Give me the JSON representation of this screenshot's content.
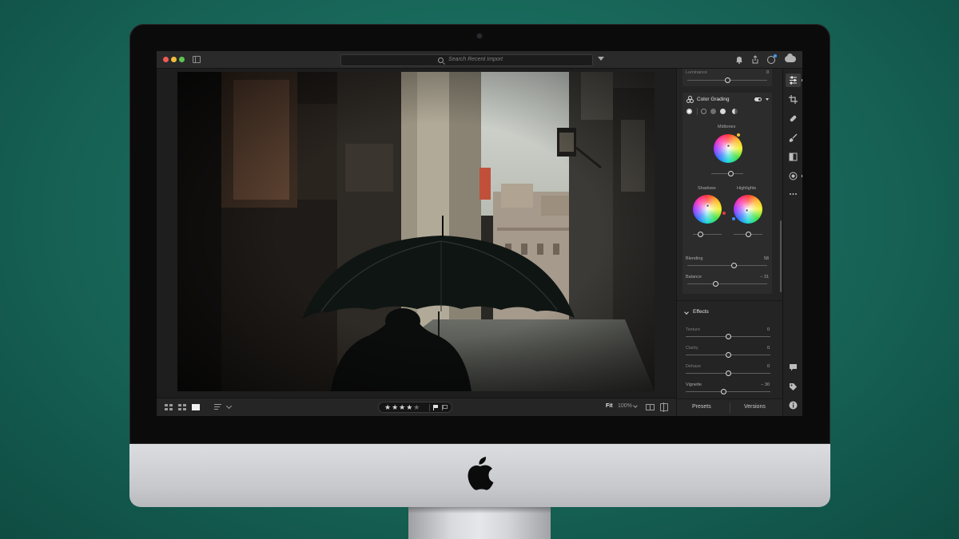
{
  "app": {
    "search_placeholder": "Search Recent Import"
  },
  "panel": {
    "luminance": {
      "label": "Luminance",
      "value": "0",
      "level": 0.5
    },
    "color_grading": {
      "title": "Color Grading",
      "midtones_label": "Midtones",
      "shadows_label": "Shadows",
      "highlights_label": "Highlights",
      "blending": {
        "label": "Blending",
        "value": "58",
        "level": 0.58
      },
      "balance": {
        "label": "Balance",
        "value": "− 31",
        "level": 0.35
      }
    },
    "effects": {
      "title": "Effects",
      "sliders": [
        {
          "label": "Texture",
          "value": "0",
          "level": 0.5
        },
        {
          "label": "Clarity",
          "value": "0",
          "level": 0.5
        },
        {
          "label": "Dehaze",
          "value": "0",
          "level": 0.5
        },
        {
          "label": "Vignette",
          "value": "− 30",
          "level": 0.45
        }
      ]
    },
    "tabs": {
      "presets": "Presets",
      "versions": "Versions"
    }
  },
  "bottombar": {
    "stars": "★★★★",
    "star_off": "★",
    "fit_label": "Fit",
    "zoom_label": "100%"
  },
  "colors": {
    "background": "#176457",
    "accent": "#3f9bf5"
  },
  "icons": [
    "sidebar-toggle-icon",
    "search-icon",
    "filter-icon",
    "bell-icon",
    "share-icon",
    "info-icon",
    "cloud-icon",
    "edit-sliders-icon",
    "crop-icon",
    "healing-icon",
    "brush-icon",
    "linear-gradient-icon",
    "radial-gradient-icon",
    "more-icon",
    "comment-icon",
    "tag-icon",
    "help-icon",
    "apple-logo"
  ]
}
